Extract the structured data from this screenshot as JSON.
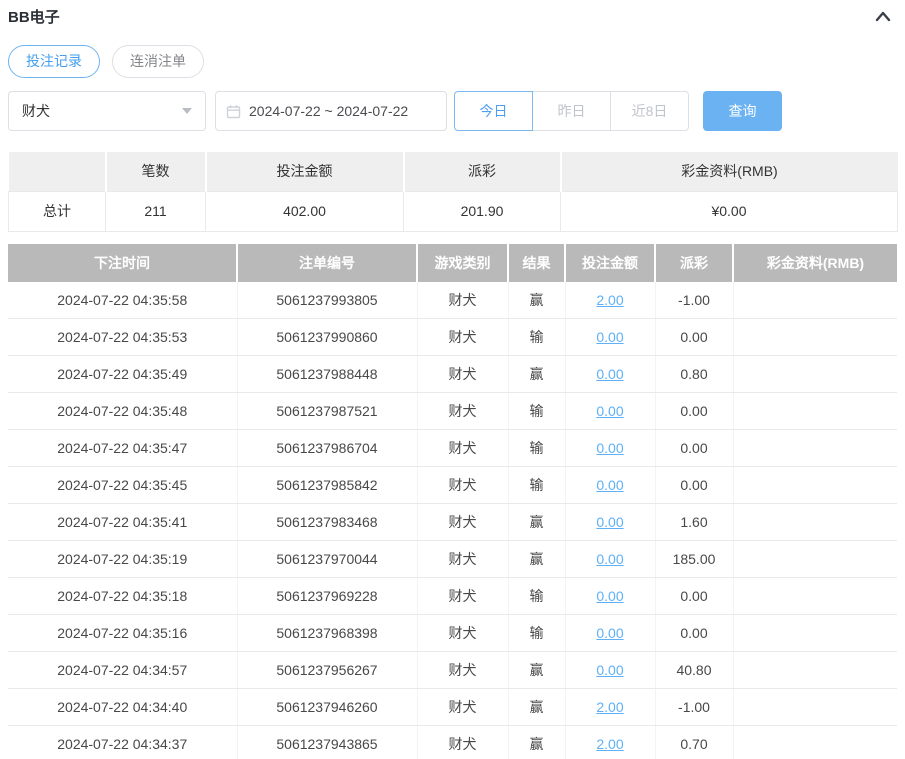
{
  "header": {
    "title": "BB电子"
  },
  "tabs": [
    {
      "label": "投注记录",
      "active": true
    },
    {
      "label": "连消注单",
      "active": false
    }
  ],
  "filters": {
    "game_select": {
      "value": "财犬"
    },
    "date_range": {
      "value": "2024-07-22 ~ 2024-07-22"
    },
    "quick_ranges": [
      {
        "label": "今日",
        "active": true
      },
      {
        "label": "昨日",
        "active": false
      },
      {
        "label": "近8日",
        "active": false
      }
    ],
    "search_label": "查询"
  },
  "summary": {
    "columns": [
      "",
      "笔数",
      "投注金额",
      "派彩",
      "彩金资料(RMB)"
    ],
    "row": {
      "label": "总计",
      "count": "211",
      "bet_amount": "402.00",
      "payout": "201.90",
      "bonus": "¥0.00"
    }
  },
  "records": {
    "columns": [
      "下注时间",
      "注单编号",
      "游戏类别",
      "结果",
      "投注金额",
      "派彩",
      "彩金资料(RMB)"
    ],
    "rows": [
      {
        "time": "2024-07-22 04:35:58",
        "bet_id": "5061237993805",
        "game": "财犬",
        "result": "赢",
        "amount": "2.00",
        "payout": "-1.00",
        "negative": true,
        "bonus": ""
      },
      {
        "time": "2024-07-22 04:35:53",
        "bet_id": "5061237990860",
        "game": "财犬",
        "result": "输",
        "amount": "0.00",
        "payout": "0.00",
        "negative": false,
        "bonus": ""
      },
      {
        "time": "2024-07-22 04:35:49",
        "bet_id": "5061237988448",
        "game": "财犬",
        "result": "赢",
        "amount": "0.00",
        "payout": "0.80",
        "negative": false,
        "bonus": ""
      },
      {
        "time": "2024-07-22 04:35:48",
        "bet_id": "5061237987521",
        "game": "财犬",
        "result": "输",
        "amount": "0.00",
        "payout": "0.00",
        "negative": false,
        "bonus": ""
      },
      {
        "time": "2024-07-22 04:35:47",
        "bet_id": "5061237986704",
        "game": "财犬",
        "result": "输",
        "amount": "0.00",
        "payout": "0.00",
        "negative": false,
        "bonus": ""
      },
      {
        "time": "2024-07-22 04:35:45",
        "bet_id": "5061237985842",
        "game": "财犬",
        "result": "输",
        "amount": "0.00",
        "payout": "0.00",
        "negative": false,
        "bonus": ""
      },
      {
        "time": "2024-07-22 04:35:41",
        "bet_id": "5061237983468",
        "game": "财犬",
        "result": "赢",
        "amount": "0.00",
        "payout": "1.60",
        "negative": false,
        "bonus": ""
      },
      {
        "time": "2024-07-22 04:35:19",
        "bet_id": "5061237970044",
        "game": "财犬",
        "result": "赢",
        "amount": "0.00",
        "payout": "185.00",
        "negative": false,
        "bonus": ""
      },
      {
        "time": "2024-07-22 04:35:18",
        "bet_id": "5061237969228",
        "game": "财犬",
        "result": "输",
        "amount": "0.00",
        "payout": "0.00",
        "negative": false,
        "bonus": ""
      },
      {
        "time": "2024-07-22 04:35:16",
        "bet_id": "5061237968398",
        "game": "财犬",
        "result": "输",
        "amount": "0.00",
        "payout": "0.00",
        "negative": false,
        "bonus": ""
      },
      {
        "time": "2024-07-22 04:34:57",
        "bet_id": "5061237956267",
        "game": "财犬",
        "result": "赢",
        "amount": "0.00",
        "payout": "40.80",
        "negative": false,
        "bonus": ""
      },
      {
        "time": "2024-07-22 04:34:40",
        "bet_id": "5061237946260",
        "game": "财犬",
        "result": "赢",
        "amount": "2.00",
        "payout": "-1.00",
        "negative": true,
        "bonus": ""
      },
      {
        "time": "2024-07-22 04:34:37",
        "bet_id": "5061237943865",
        "game": "财犬",
        "result": "赢",
        "amount": "2.00",
        "payout": "0.70",
        "negative": false,
        "bonus": ""
      }
    ]
  },
  "colors": {
    "accent_blue": "#5fa8f0",
    "link_blue": "#5fb0f5",
    "negative_red": "#f16e6e",
    "table_header_gray": "#b9b9b9"
  }
}
